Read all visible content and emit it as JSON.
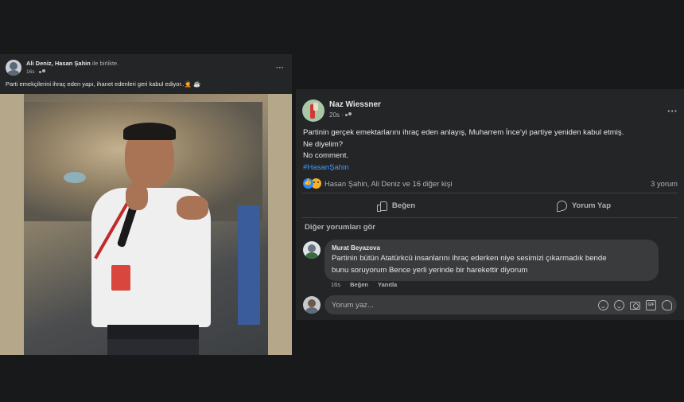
{
  "left_post": {
    "author_names": "Ali Deniz, Hasan Şahin",
    "with_text": "ile birlikte.",
    "time": "16s ·",
    "menu": "···",
    "text": "Parti emekçilerini ihraç eden yapı, ihanet edenleri geri kabul ediyor..🤦 ☕"
  },
  "right_post": {
    "author": "Naz Wiessner",
    "time": "20s ·",
    "menu": "···",
    "body_lines": [
      "Partinin gerçek emektarlarını ihraç eden anlayış, Muharrem İnce'yi partiye yeniden kabul etmiş.",
      "Ne diyelim?",
      "No comment."
    ],
    "hashtag": "#HasanŞahin",
    "reactions_text": "Hasan Şahin, Ali Deniz ve 16 diğer kişi",
    "comment_count": "3 yorum",
    "like_button": "Beğen",
    "comment_button": "Yorum Yap",
    "more_comments": "Diğer yorumları gör",
    "comment": {
      "author": "Murat Beyazova",
      "text_line1": "Partinin bütün Atatürkcü insanlarını ihraç ederken niye sesimizi çıkarmadık bende",
      "text_line2": "bunu soruyorum Bence yerli yerinde bir harekettir diyorum",
      "time": "16s",
      "like": "Beğen",
      "reply": "Yanıtla"
    },
    "write_placeholder": "Yorum yaz...",
    "write_gif": "GIF"
  }
}
